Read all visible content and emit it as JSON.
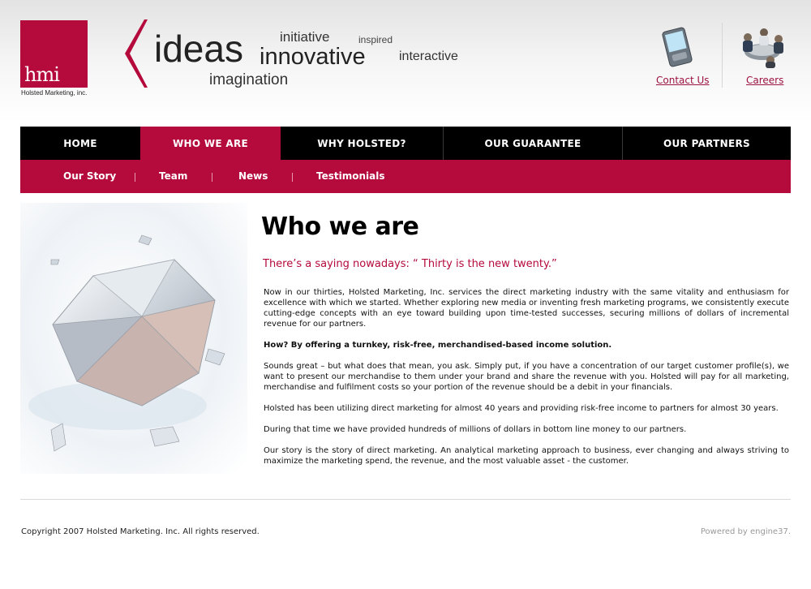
{
  "header": {
    "logo_text": "hmi",
    "logo_caption": "Holsted Marketing, inc.",
    "words": {
      "ideas": "ideas",
      "initiative": "initiative",
      "innovative": "innovative",
      "inspired": "inspired",
      "interactive": "interactive",
      "imagination": "imagination"
    },
    "contact_label": "Contact Us",
    "careers_label": "Careers"
  },
  "nav": {
    "items": [
      {
        "label": "HOME"
      },
      {
        "label": "WHO WE ARE",
        "active": true
      },
      {
        "label": "WHY HOLSTED?"
      },
      {
        "label": "OUR GUARANTEE"
      },
      {
        "label": "OUR PARTNERS"
      }
    ]
  },
  "subnav": {
    "items": [
      {
        "label": "Our Story"
      },
      {
        "label": "Team"
      },
      {
        "label": "News"
      },
      {
        "label": "Testimonials"
      }
    ]
  },
  "main": {
    "title": "Who we are",
    "tagline": "There’s a saying nowadays: “ Thirty is the new twenty.”",
    "paragraphs": [
      "Now in our thirties, Holsted Marketing, Inc. services the direct marketing industry with the same vitality and enthusiasm for excellence with which we started.  Whether exploring new media or inventing fresh marketing programs, we consistently execute cutting-edge concepts with an eye toward building upon time-tested successes, securing millions of dollars of incremental revenue for our partners.",
      "How? By offering a turnkey, risk-free, merchandised-based income solution.",
      "Sounds great – but what does that mean, you ask. Simply put, if you have a concentration of our target customer profile(s), we want to present our merchandise to them under your brand and share the revenue with you. Holsted will pay for all marketing, merchandise and fulfilment costs so your portion of the revenue should be a debit in your financials.",
      "Holsted has been utilizing direct marketing for almost 40 years and providing risk-free income to partners for almost 30 years.",
      "During that time we have provided hundreds of millions of dollars in bottom line money to our partners.",
      "Our story is the story of direct marketing. An analytical marketing approach to business, ever changing and always striving to maximize the marketing spend, the revenue, and the most valuable asset - the customer."
    ]
  },
  "footer": {
    "copyright": "Copyright 2007 Holsted Marketing. Inc. All rights reserved.",
    "powered": "Powered by engine37."
  },
  "colors": {
    "brand": "#b40a3c",
    "nav_bg": "#000000"
  },
  "icons": [
    "pda-icon",
    "people-meeting-icon",
    "chevron-left-icon",
    "diamond-image"
  ]
}
